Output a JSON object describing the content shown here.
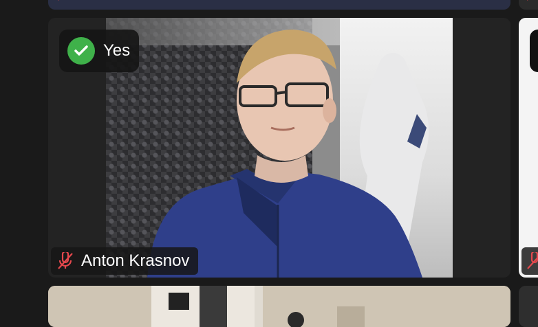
{
  "main_tile": {
    "participant_name": "Anton Krasnov",
    "reaction_label": "Yes",
    "reaction_color": "#3fb14a",
    "mic_state": "muted",
    "icons": [
      "check-icon",
      "microphone-muted-icon"
    ]
  },
  "partial_tiles": {
    "top_row_mic_state": "muted",
    "right_tile_mic_state": "muted"
  },
  "colors": {
    "background": "#1a1a1a",
    "tile_background": "#232323",
    "muted_icon": "#e5484d"
  }
}
